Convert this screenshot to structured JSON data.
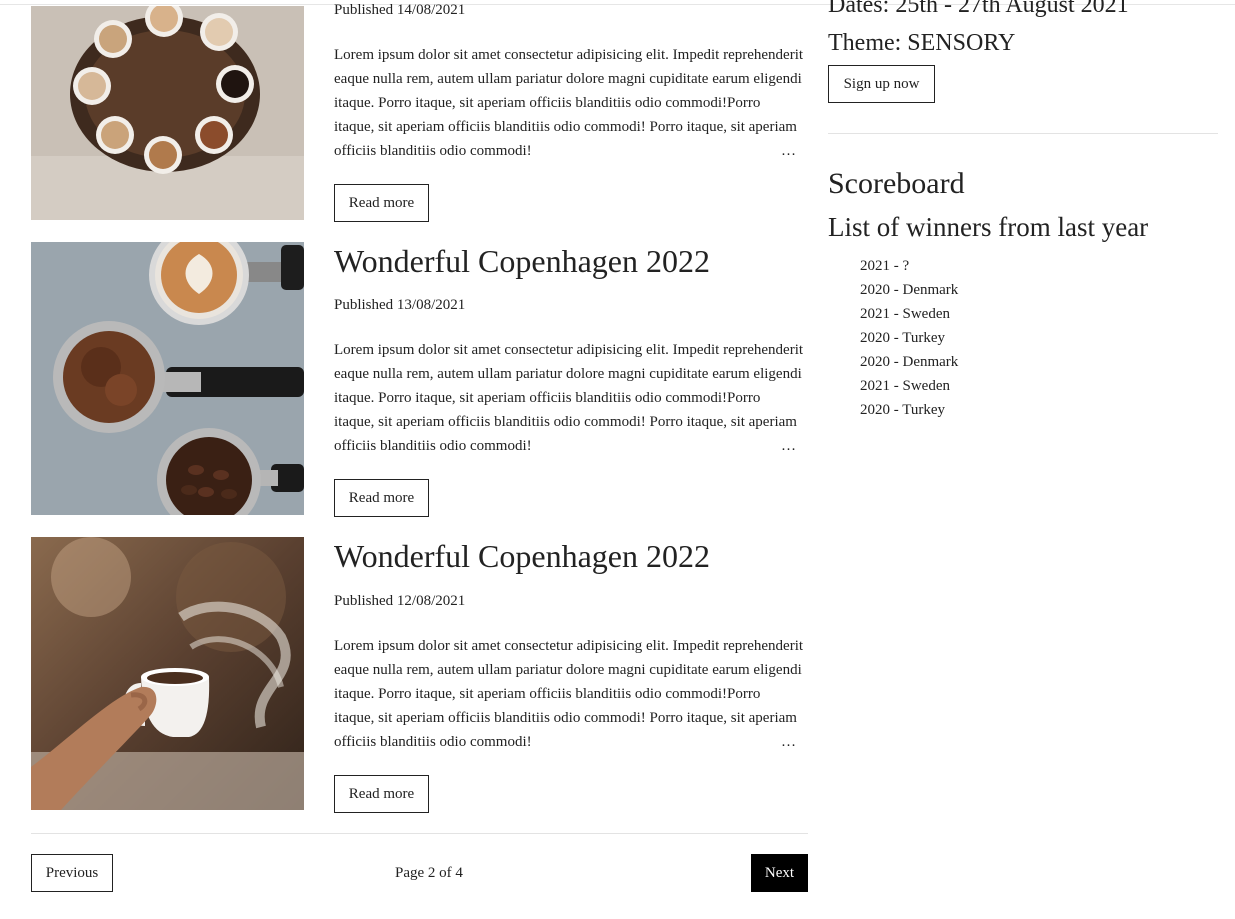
{
  "posts": [
    {
      "title": "",
      "date": "Published 14/08/2021",
      "excerpt": "Lorem ipsum dolor sit amet consectetur adipisicing elit. Impedit reprehenderit eaque nulla rem, autem ullam pariatur dolore magni cupiditate earum eligendi itaque. Porro itaque, sit aperiam officiis blanditiis odio commodi!Porro itaque, sit aperiam officiis blanditiis odio commodi! Porro itaque, sit aperiam officiis blanditiis odio commodi!",
      "ellipsis": "…",
      "read_more": "Read more",
      "image": "coffee-cups-tray-photo"
    },
    {
      "title": "Wonderful Copenhagen 2022",
      "date": "Published 13/08/2021",
      "excerpt": "Lorem ipsum dolor sit amet consectetur adipisicing elit. Impedit reprehenderit eaque nulla rem, autem ullam pariatur dolore magni cupiditate earum eligendi itaque. Porro itaque, sit aperiam officiis blanditiis odio commodi!Porro itaque, sit aperiam officiis blanditiis odio commodi! Porro itaque, sit aperiam officiis blanditiis odio commodi!",
      "ellipsis": "…",
      "read_more": "Read more",
      "image": "espresso-portafilters-photo"
    },
    {
      "title": "Wonderful Copenhagen 2022",
      "date": "Published 12/08/2021",
      "excerpt": "Lorem ipsum dolor sit amet consectetur adipisicing elit. Impedit reprehenderit eaque nulla rem, autem ullam pariatur dolore magni cupiditate earum eligendi itaque. Porro itaque, sit aperiam officiis blanditiis odio commodi!Porro itaque, sit aperiam officiis blanditiis odio commodi! Porro itaque, sit aperiam officiis blanditiis odio commodi!",
      "ellipsis": "…",
      "read_more": "Read more",
      "image": "steaming-coffee-cup-photo"
    }
  ],
  "pagination": {
    "previous": "Previous",
    "page_info": "Page 2 of 4",
    "next": "Next"
  },
  "sidebar": {
    "dates": "Dates: 25th - 27th August 2021",
    "theme": "Theme: SENSORY",
    "signup": "Sign up now",
    "scoreboard_title": "Scoreboard",
    "winners_title": "List of winners from last year",
    "winners": [
      "2021 - ?",
      "2020 - Denmark",
      "2021 - Sweden",
      "2020 - Turkey",
      "2020 - Denmark",
      "2021 - Sweden",
      "2020 - Turkey"
    ]
  },
  "colors": {
    "text": "#222222",
    "divider": "#e3e3e3",
    "next_button_bg": "#000000"
  }
}
